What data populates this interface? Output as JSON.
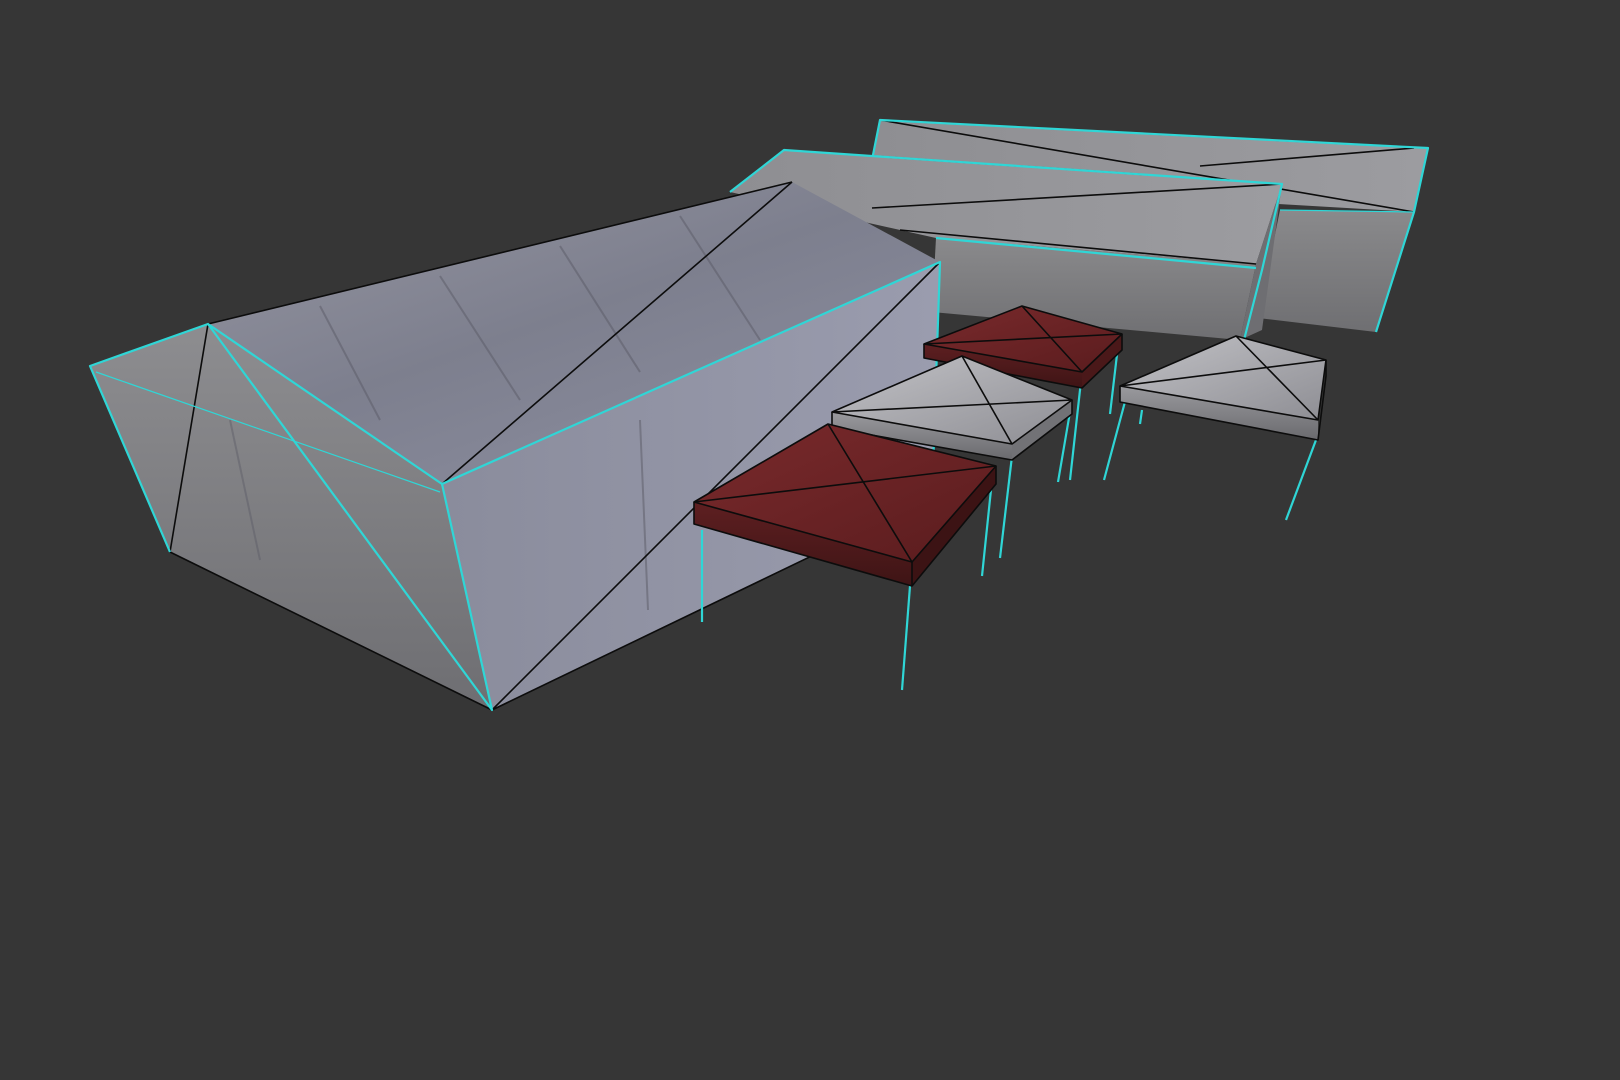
{
  "viewport": {
    "background_color": "#363636",
    "selection_wire_color": "#2fd6d6",
    "edge_wire_color": "#0c0c0c",
    "display_mode": "shaded-with-wireframe-on-selection"
  },
  "scene": {
    "objects": [
      {
        "name": "large-tent",
        "material": "tent-fabric-grey",
        "color": "#8c8ea0",
        "selected": true
      },
      {
        "name": "back-tent-1",
        "material": "tent-fabric-grey",
        "color": "#8a8a8e",
        "selected": true
      },
      {
        "name": "back-tent-2",
        "material": "tent-fabric-grey",
        "color": "#8f8f92",
        "selected": true
      },
      {
        "name": "canopy-red-front",
        "material": "canopy-fabric-red",
        "color": "#6b2426",
        "selected": true
      },
      {
        "name": "canopy-white-middle",
        "material": "canopy-fabric-white",
        "color": "#a8a8ac",
        "selected": true
      },
      {
        "name": "canopy-red-back",
        "material": "canopy-fabric-red",
        "color": "#6e2628",
        "selected": true
      },
      {
        "name": "canopy-white-right",
        "material": "canopy-fabric-white",
        "color": "#b0b0b4",
        "selected": true
      }
    ]
  }
}
